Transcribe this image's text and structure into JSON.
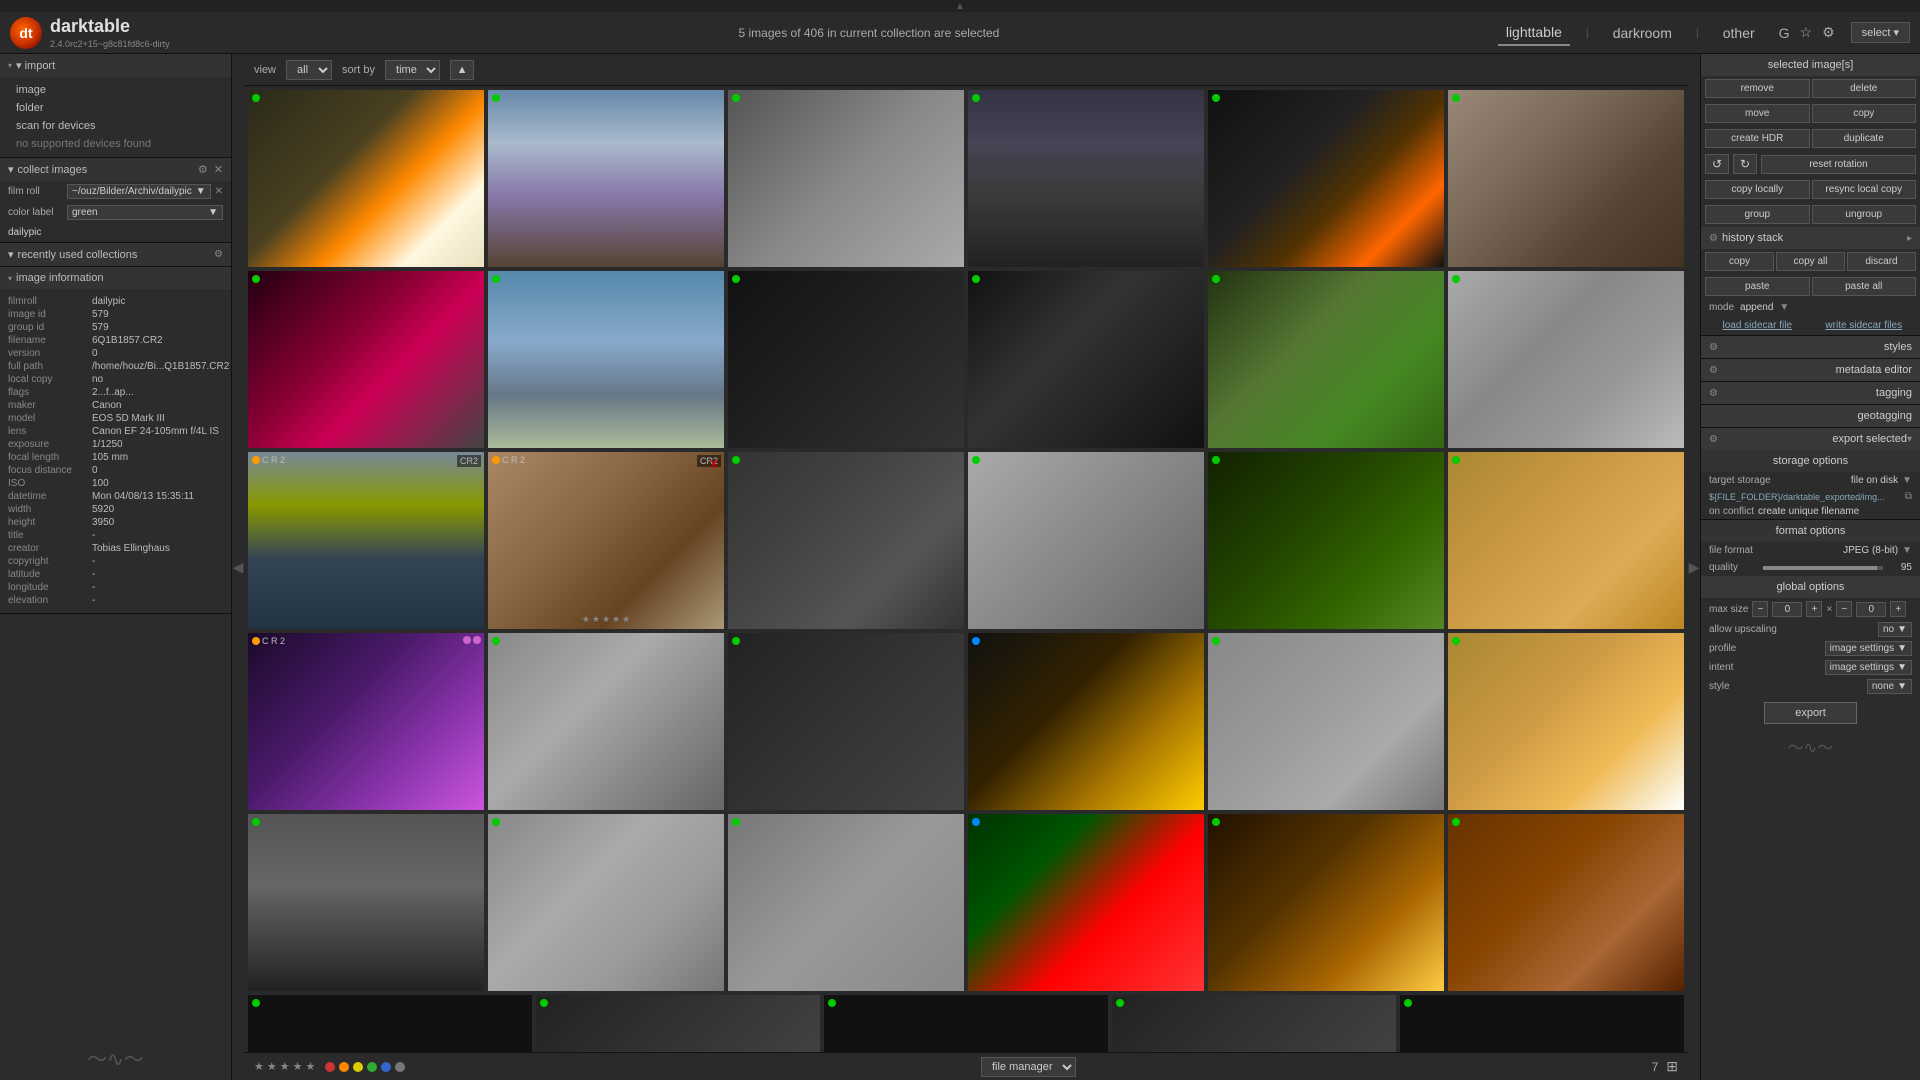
{
  "app": {
    "name": "darktable",
    "version": "2.4.0rc2+15~g8c81fd8c6-dirty"
  },
  "header": {
    "collection_info": "5 images of 406 in current collection are selected",
    "nav": {
      "lighttable": "lighttable",
      "darkroom": "darkroom",
      "other": "other"
    },
    "icons": [
      "G",
      "☆",
      "⚙"
    ],
    "select_label": "select ▾"
  },
  "toolbar": {
    "view_label": "view",
    "view_value": "all",
    "sort_label": "sort by",
    "sort_value": "time",
    "sort_btn": "▲"
  },
  "left_sidebar": {
    "import_label": "▾ import",
    "import_items": [
      "image",
      "folder",
      "scan for devices",
      "no supported devices found"
    ],
    "collect_label": "▾ collect images",
    "film_roll_label": "film roll",
    "film_roll_value": "~/ouz/Bilder/Archiv/dailypic",
    "color_label": "color label",
    "color_value": "green",
    "collection_label": "dailypic",
    "recently_label": "▾ recently used collections",
    "image_info_label": "▾ image information",
    "info_fields": {
      "filmroll": {
        "label": "filmroll",
        "value": "dailypic"
      },
      "image_id": {
        "label": "image id",
        "value": "579"
      },
      "group_id": {
        "label": "group id",
        "value": "579"
      },
      "filename": {
        "label": "filename",
        "value": "6Q1B1857.CR2"
      },
      "version": {
        "label": "version",
        "value": "0"
      },
      "full_path": {
        "label": "full path",
        "value": "/home/houz/Bi...Q1B1857.CR2"
      },
      "local_copy": {
        "label": "local copy",
        "value": "no"
      },
      "flags": {
        "label": "flags",
        "value": "2...f..ap..."
      },
      "maker": {
        "label": "maker",
        "value": "Canon"
      },
      "model": {
        "label": "model",
        "value": "EOS 5D Mark III"
      },
      "lens": {
        "label": "lens",
        "value": "Canon EF 24-105mm f/4L IS"
      },
      "exposure": {
        "label": "exposure",
        "value": "1/1250"
      },
      "focal_length": {
        "label": "focal length",
        "value": "105 mm"
      },
      "focus_distance": {
        "label": "focus distance",
        "value": "0"
      },
      "iso": {
        "label": "ISO",
        "value": "100"
      },
      "datetime": {
        "label": "datetime",
        "value": "Mon 04/08/13 15:35:11"
      },
      "width": {
        "label": "width",
        "value": "5920"
      },
      "height": {
        "label": "height",
        "value": "3950"
      },
      "title": {
        "label": "title",
        "value": "-"
      },
      "creator": {
        "label": "creator",
        "value": "Tobias Ellinghaus"
      },
      "copyright": {
        "label": "copyright",
        "value": "-"
      },
      "latitude": {
        "label": "latitude",
        "value": "-"
      },
      "longitude": {
        "label": "longitude",
        "value": "-"
      },
      "elevation": {
        "label": "elevation",
        "value": "-"
      }
    }
  },
  "right_sidebar": {
    "selected_images_label": "selected image[s]",
    "buttons": {
      "remove": "remove",
      "delete": "delete",
      "move": "move",
      "copy": "copy",
      "create_hdr": "create HDR",
      "duplicate": "duplicate",
      "reset_rotation": "reset rotation",
      "copy_locally": "copy locally",
      "resync_local_copy": "resync local copy",
      "group": "group",
      "ungroup": "ungroup"
    },
    "history_stack_label": "history stack",
    "history_buttons": {
      "copy": "copy",
      "copy_all": "copy all",
      "discard": "discard",
      "paste": "paste",
      "paste_all": "paste all"
    },
    "mode_label": "mode",
    "mode_value": "append",
    "load_sidecar": "load sidecar file",
    "write_sidecar": "write sidecar files",
    "styles_label": "styles",
    "metadata_editor_label": "metadata editor",
    "tagging_label": "tagging",
    "geotagging_label": "geotagging",
    "export_selected_label": "export selected",
    "storage_options_label": "storage options",
    "target_storage_label": "target storage",
    "target_storage_value": "file on disk",
    "filepath": "${FILE_FOLDER}/darktable_exported/img...",
    "on_conflict_label": "on conflict",
    "on_conflict_value": "create unique filename",
    "format_options_label": "format options",
    "file_format_label": "file format",
    "file_format_value": "JPEG (8-bit)",
    "quality_label": "quality",
    "quality_value": "95",
    "global_options_label": "global options",
    "max_size_label": "max size",
    "max_size_w": "0",
    "max_size_h": "0",
    "allow_upscaling_label": "allow upscaling",
    "allow_upscaling_value": "no",
    "profile_label": "profile",
    "profile_value": "image settings",
    "intent_label": "intent",
    "intent_value": "image settings",
    "style_label": "style",
    "style_value": "none",
    "export_btn": "export"
  },
  "bottom_bar": {
    "view_label": "file manager",
    "page_number": "7",
    "color_dots": [
      "red",
      "#ff6600",
      "#ddaa00",
      "#228800",
      "#224488",
      "#666666"
    ]
  },
  "grid": {
    "rows": [
      [
        {
          "class": "img-egg",
          "dot": "green",
          "badge": null
        },
        {
          "class": "img-owl",
          "dot": "green",
          "badge": null
        },
        {
          "class": "img-needle",
          "dot": "green",
          "badge": null
        },
        {
          "class": "img-city",
          "dot": "green",
          "badge": null
        },
        {
          "class": "img-light",
          "dot": "green",
          "badge": null
        },
        {
          "class": "img-deer",
          "dot": "green",
          "badge": null
        }
      ],
      [
        {
          "class": "img-guitar",
          "dot": "green",
          "badge": null
        },
        {
          "class": "img-chain",
          "dot": "green",
          "badge": null
        },
        {
          "class": "img-silhouette",
          "dot": "green",
          "badge": null
        },
        {
          "class": "img-handlebar",
          "dot": "green",
          "badge": null
        },
        {
          "class": "img-moss",
          "dot": "green",
          "badge": null
        },
        {
          "class": "img-crack",
          "dot": "green",
          "badge": null
        }
      ],
      [
        {
          "class": "img-skater",
          "dot": "orange",
          "badge": "CR2"
        },
        {
          "class": "img-texture",
          "dot": "orange",
          "badge": "CR2",
          "reject": true,
          "rating": [
            false,
            false,
            false,
            false,
            false
          ]
        },
        {
          "class": "img-metro",
          "dot": "green",
          "badge": null
        },
        {
          "class": "img-sign",
          "dot": "green",
          "badge": null
        },
        {
          "class": "img-fern",
          "dot": "green",
          "badge": null
        },
        {
          "class": "img-drinks",
          "dot": "green",
          "badge": null
        }
      ],
      [
        {
          "class": "img-hair",
          "dot": "orange",
          "overlay": [
            "C",
            "R",
            "2"
          ]
        },
        {
          "class": "img-clock",
          "dot": "green",
          "badge": null
        },
        {
          "class": "img-curve",
          "dot": "green",
          "badge": null
        },
        {
          "class": "img-bulbs",
          "dot": "blue",
          "badge": null
        },
        {
          "class": "img-graffiti",
          "dot": "green",
          "badge": null
        },
        {
          "class": "img-spaniel",
          "dot": "green",
          "badge": null
        }
      ],
      [
        {
          "class": "img-arch",
          "dot": "green",
          "badge": null
        },
        {
          "class": "img-ruins",
          "dot": "green",
          "badge": null
        },
        {
          "class": "img-stones",
          "dot": "green",
          "badge": null
        },
        {
          "class": "img-tulip",
          "dot": "blue",
          "badge": null
        },
        {
          "class": "img-jar",
          "dot": "green",
          "badge": null
        },
        {
          "class": "img-doorway",
          "dot": "green",
          "badge": null
        }
      ],
      [
        {
          "class": "img-dark",
          "dot": "green",
          "badge": null
        },
        {
          "class": "img-partial",
          "dot": "green",
          "badge": null
        },
        {
          "class": "img-dark",
          "dot": "green",
          "badge": null
        },
        {
          "class": "img-partial",
          "dot": "green",
          "badge": null
        },
        {
          "class": "img-dark",
          "dot": "green",
          "badge": null
        }
      ]
    ]
  }
}
